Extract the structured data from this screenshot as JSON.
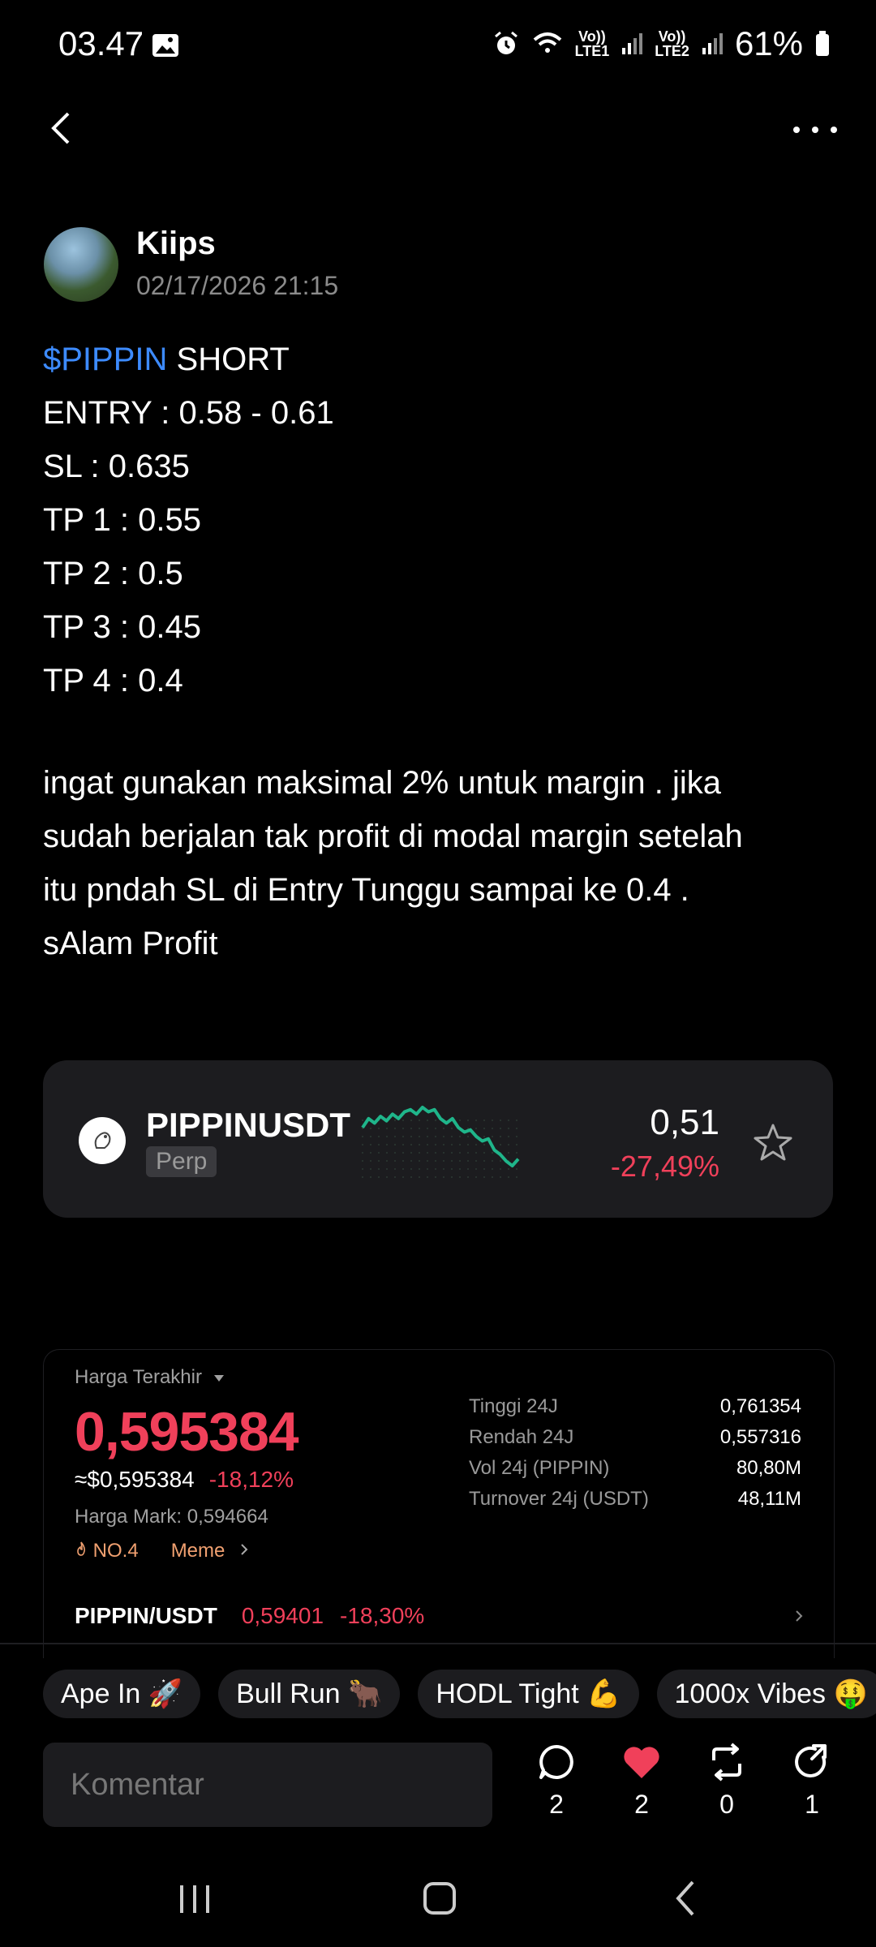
{
  "status_bar": {
    "time": "03.47",
    "sim1": "Vo))\nLTE1",
    "sim2": "Vo))\nLTE2",
    "battery": "61%",
    "icons": [
      "image-icon",
      "alarm-icon",
      "wifi-icon",
      "signal-icon",
      "battery-icon"
    ]
  },
  "post": {
    "author": "Kiips",
    "date": "02/17/2026 21:15",
    "ticker_link": "$PIPPIN",
    "lines": [
      " SHORT",
      "ENTRY : 0.58 - 0.61",
      "SL : 0.635",
      "TP 1 : 0.55",
      "TP 2 : 0.5",
      "TP 3 : 0.45",
      "TP 4 : 0.4"
    ],
    "paragraph_lines": [
      "ingat gunakan maksimal 2% untuk margin . jika",
      "sudah berjalan tak profit di modal margin setelah",
      "itu pndah SL di Entry Tunggu sampai ke 0.4 .",
      "sAlam Profit"
    ]
  },
  "ticker_card": {
    "symbol": "PIPPINUSDT",
    "type": "Perp",
    "price": "0,51",
    "change": "-27,49%",
    "sparkline_color": "#1fb58a",
    "sparkline": [
      0.62,
      0.66,
      0.64,
      0.67,
      0.65,
      0.68,
      0.66,
      0.69,
      0.7,
      0.68,
      0.71,
      0.69,
      0.7,
      0.66,
      0.64,
      0.66,
      0.62,
      0.6,
      0.61,
      0.58,
      0.56,
      0.57,
      0.52,
      0.5,
      0.47,
      0.45,
      0.48
    ]
  },
  "market": {
    "last_price_label": "Harga Terakhir",
    "last_price": "0,595384",
    "usd_price": "≈$0,595384",
    "usd_change": "-18,12%",
    "mark_label": "Harga Mark:",
    "mark_value": "0,594664",
    "rank": "NO.4",
    "category": "Meme",
    "stats": [
      {
        "label": "Tinggi 24J",
        "value": "0,761354"
      },
      {
        "label": "Rendah 24J",
        "value": "0,557316"
      },
      {
        "label": "Vol 24j (PIPPIN)",
        "value": "80,80M"
      },
      {
        "label": "Turnover 24j (USDT)",
        "value": "48,11M"
      }
    ],
    "spot_pair": "PIPPIN/USDT",
    "spot_price": "0,59401",
    "spot_change": "-18,30%",
    "accent_red": "#f0405a"
  },
  "reactions": [
    {
      "label": "Ape In 🚀"
    },
    {
      "label": "Bull Run 🐂"
    },
    {
      "label": "HODL Tight 💪"
    },
    {
      "label": "1000x Vibes 🤑"
    }
  ],
  "comment": {
    "placeholder": "Komentar"
  },
  "actions": {
    "comments": "2",
    "likes": "2",
    "reposts": "0",
    "shares": "1"
  }
}
